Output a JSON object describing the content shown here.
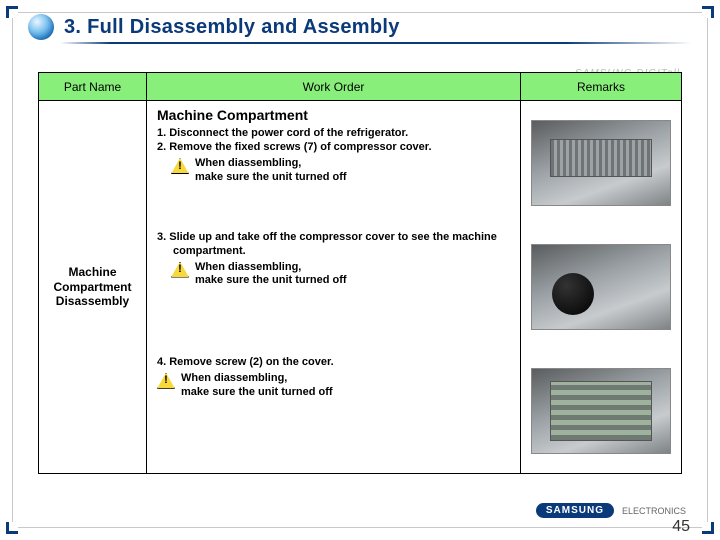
{
  "header": {
    "title": "3. Full Disassembly and Assembly"
  },
  "table": {
    "columns": {
      "part": "Part Name",
      "work": "Work Order",
      "remarks": "Remarks"
    },
    "part_name": "Machine Compartment Disassembly",
    "sections": [
      {
        "title": "Machine Compartment",
        "steps": [
          "1. Disconnect the power cord of the refrigerator.",
          "2. Remove the fixed screws (7) of compressor cover."
        ],
        "caution": "When diassembling,\nmake sure the unit turned off"
      },
      {
        "title": "",
        "steps": [
          "3. Slide up and take off the compressor cover to see the machine compartment."
        ],
        "caution": "When diassembling,\nmake sure the unit turned off"
      },
      {
        "title": "",
        "steps": [
          "4. Remove screw (2) on the cover."
        ],
        "caution": "When diassembling,\nmake sure the unit turned off"
      }
    ]
  },
  "brand": {
    "name": "SAMSUNG",
    "sub": "ELECTRONICS",
    "watermark": "SAMSUNG DIGITall"
  },
  "page": "45"
}
